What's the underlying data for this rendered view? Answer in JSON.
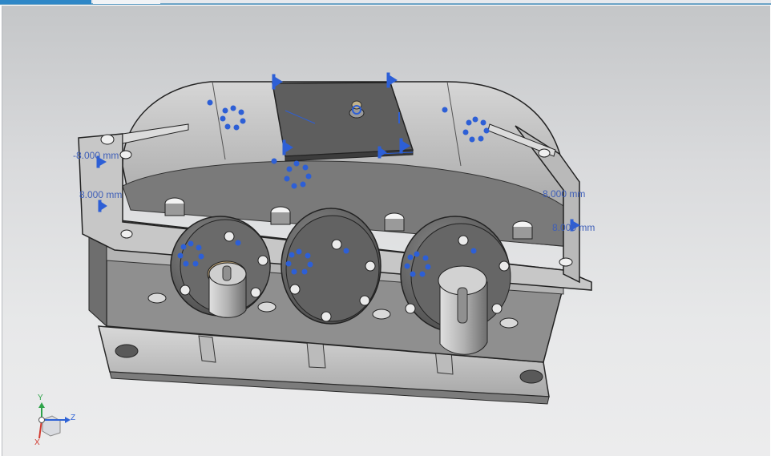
{
  "tabs": [
    {
      "label": "",
      "active": true
    },
    {
      "label": "",
      "active": false
    }
  ],
  "dimensions": [
    {
      "id": "dim-left-top",
      "text": "-8.000 mm"
    },
    {
      "id": "dim-left-mid",
      "text": "8.000 mm"
    },
    {
      "id": "dim-right-top",
      "text": "8.000 mm"
    },
    {
      "id": "dim-right-bottom",
      "text": "8.000 mm"
    }
  ],
  "triad": {
    "x": "X",
    "y": "Y",
    "z": "Z"
  },
  "colors": {
    "viewport_top": "#c4c6c8",
    "viewport_bottom": "#ececed",
    "constraint_blue": "#2d5fd6",
    "axis_x": "#d23a2f",
    "axis_y": "#2fa34a",
    "axis_z": "#2f63d6",
    "tab_active": "#2e87c7"
  },
  "icons": [
    "datum-pin-icon",
    "hole-pattern-icon",
    "view-triad-icon"
  ]
}
